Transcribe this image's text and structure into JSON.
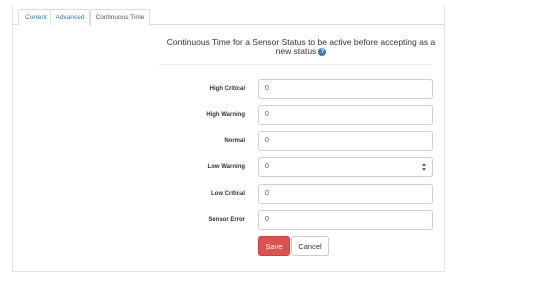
{
  "tabs": [
    {
      "label": "Current"
    },
    {
      "label": "Advanced"
    },
    {
      "label": "Continuous Time"
    }
  ],
  "form": {
    "title": "Continuous Time for a Sensor Status to be active before accepting as a new status",
    "help_icon": "question-circle-icon",
    "fields": [
      {
        "label": "High Critical",
        "value": "0"
      },
      {
        "label": "High Warning",
        "value": "0"
      },
      {
        "label": "Normal",
        "value": "0"
      },
      {
        "label": "Low Warning",
        "value": "0"
      },
      {
        "label": "Low Critical",
        "value": "0"
      },
      {
        "label": "Sensor Error",
        "value": "0"
      }
    ],
    "save_label": "Save",
    "cancel_label": "Cancel"
  },
  "colors": {
    "accent": "#337ab7",
    "save": "#d9534f"
  }
}
